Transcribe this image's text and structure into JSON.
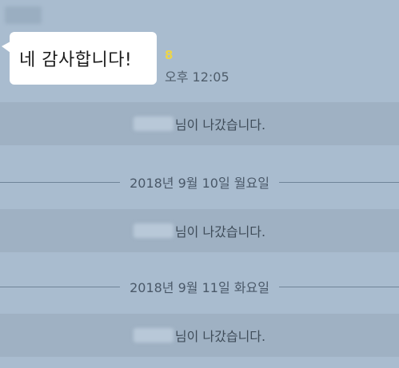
{
  "chat": {
    "message": {
      "text": "네 감사합니다!",
      "unread_count": "8",
      "time": "오후 12:05"
    },
    "notices": [
      {
        "text": "님이 나갔습니다."
      },
      {
        "text": "님이 나갔습니다."
      },
      {
        "text": "님이 나갔습니다."
      }
    ],
    "date_separators": [
      {
        "label": "2018년 9월 10일 월요일"
      },
      {
        "label": "2018년 9월 11일 화요일"
      }
    ]
  }
}
